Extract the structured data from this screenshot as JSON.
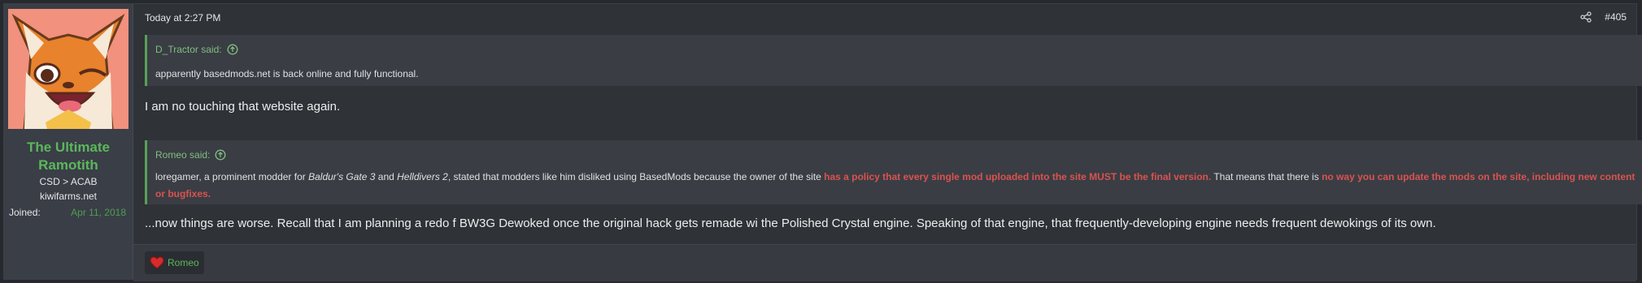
{
  "user": {
    "name_line1": "The Ultimate",
    "name_line2": "Ramotith",
    "title_line1": "CSD > ACAB",
    "title_line2": "kiwifarms.net",
    "joined_label": "Joined:",
    "joined_value": "Apr 11, 2018"
  },
  "post": {
    "time": "Today at 2:27 PM",
    "number": "#405"
  },
  "quote1": {
    "author": "D_Tractor said:",
    "text": "apparently basedmods.net is back online and fully functional."
  },
  "message1": "I am no touching that website again.",
  "quote2": {
    "author": "Romeo said:",
    "t1": "loregamer, a prominent modder for ",
    "i1": "Baldur's Gate 3",
    "t2": " and ",
    "i2": "Helldivers 2",
    "t3": ", stated that modders like him disliked using BasedMods because the owner of the site ",
    "r1": "has a policy that every single mod uploaded into the site MUST be the final version.",
    "t4": " That means that there is ",
    "r2": "no way you can update the mods on the site, including new content or bugfixes."
  },
  "message2": "...now things are worse. Recall that I am planning a redo f BW3G Dewoked once the original hack gets remade wi the Polished Crystal engine. Speaking of that engine, that frequently-developing engine needs frequent dewokings of its own.",
  "reaction": {
    "icon": "heart-icon",
    "name": "Romeo"
  }
}
